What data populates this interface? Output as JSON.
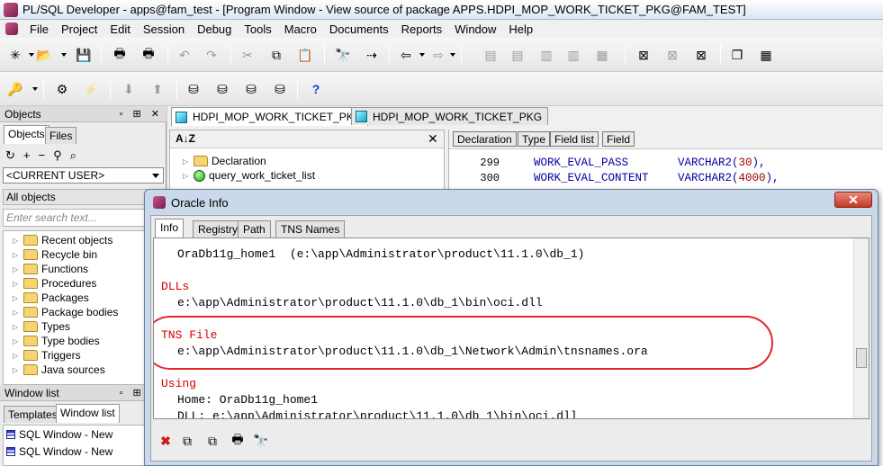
{
  "window": {
    "title": "PL/SQL Developer - apps@fam_test - [Program Window - View source of package APPS.HDPI_MOP_WORK_TICKET_PKG@FAM_TEST]"
  },
  "menu": [
    "File",
    "Project",
    "Edit",
    "Session",
    "Debug",
    "Tools",
    "Macro",
    "Documents",
    "Reports",
    "Window",
    "Help"
  ],
  "left_panel": {
    "objects_title": "Objects",
    "tabs": [
      "Objects",
      "Files"
    ],
    "user_filter": "<CURRENT USER>",
    "object_filter": "All objects",
    "search_placeholder": "Enter search text...",
    "tree": [
      "Recent objects",
      "Recycle bin",
      "Functions",
      "Procedures",
      "Packages",
      "Package bodies",
      "Types",
      "Type bodies",
      "Triggers",
      "Java sources"
    ],
    "window_list_title": "Window list",
    "window_list_tabs": [
      "Templates",
      "Window list"
    ],
    "windows": [
      "SQL Window - New",
      "SQL Window - New"
    ]
  },
  "editor": {
    "tabs": [
      "HDPI_MOP_WORK_TICKET_PKG",
      "HDPI_MOP_WORK_TICKET_PKG"
    ],
    "navigator": [
      "Declaration",
      "query_work_ticket_list"
    ],
    "code_buttons": [
      "Declaration",
      "Type",
      "Field list",
      "Field"
    ],
    "lines": [
      {
        "num": "299",
        "name": "WORK_EVAL_PASS",
        "type": "VARCHAR2(",
        "size": "30",
        "end": "),"
      },
      {
        "num": "300",
        "name": "WORK_EVAL_CONTENT",
        "type": "VARCHAR2(",
        "size": "4000",
        "end": "),"
      }
    ]
  },
  "dialog": {
    "title": "Oracle Info",
    "close": "✕",
    "tabs": [
      "Info",
      "Registry",
      "Path",
      "TNS Names"
    ],
    "content": {
      "home_line": "OraDb11g_home1  (e:\\app\\Administrator\\product\\11.1.0\\db_1)",
      "dlls_header": "DLLs",
      "dlls_path": "e:\\app\\Administrator\\product\\11.1.0\\db_1\\bin\\oci.dll",
      "tns_header": "TNS File",
      "tns_path": "e:\\app\\Administrator\\product\\11.1.0\\db_1\\Network\\Admin\\tnsnames.ora",
      "using_header": "Using",
      "using_home": "Home: OraDb11g_home1",
      "using_dll": "DLL: e:\\app\\Administrator\\product\\11.1.0\\db_1\\bin\\oci.dll"
    }
  }
}
